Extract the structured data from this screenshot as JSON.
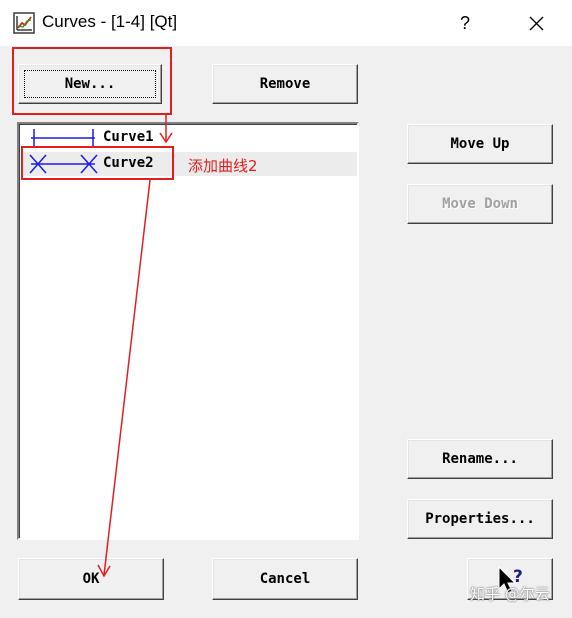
{
  "window": {
    "title": "Curves - [1-4] [Qt]",
    "help_label": "?"
  },
  "buttons": {
    "new": "New...",
    "remove": "Remove",
    "move_up": "Move Up",
    "move_down": "Move Down",
    "rename": "Rename...",
    "properties": "Properties...",
    "ok": "OK",
    "cancel": "Cancel"
  },
  "curves": [
    {
      "label": "Curve1",
      "marker": "plus",
      "selected": false
    },
    {
      "label": "Curve2",
      "marker": "cross",
      "selected": true
    }
  ],
  "annotation": {
    "text": "添加曲线2",
    "color": "#e02020"
  },
  "watermark": "知乎 @尔云",
  "colors": {
    "curve_line": "#1c1ce6",
    "annotation": "#e02020"
  }
}
